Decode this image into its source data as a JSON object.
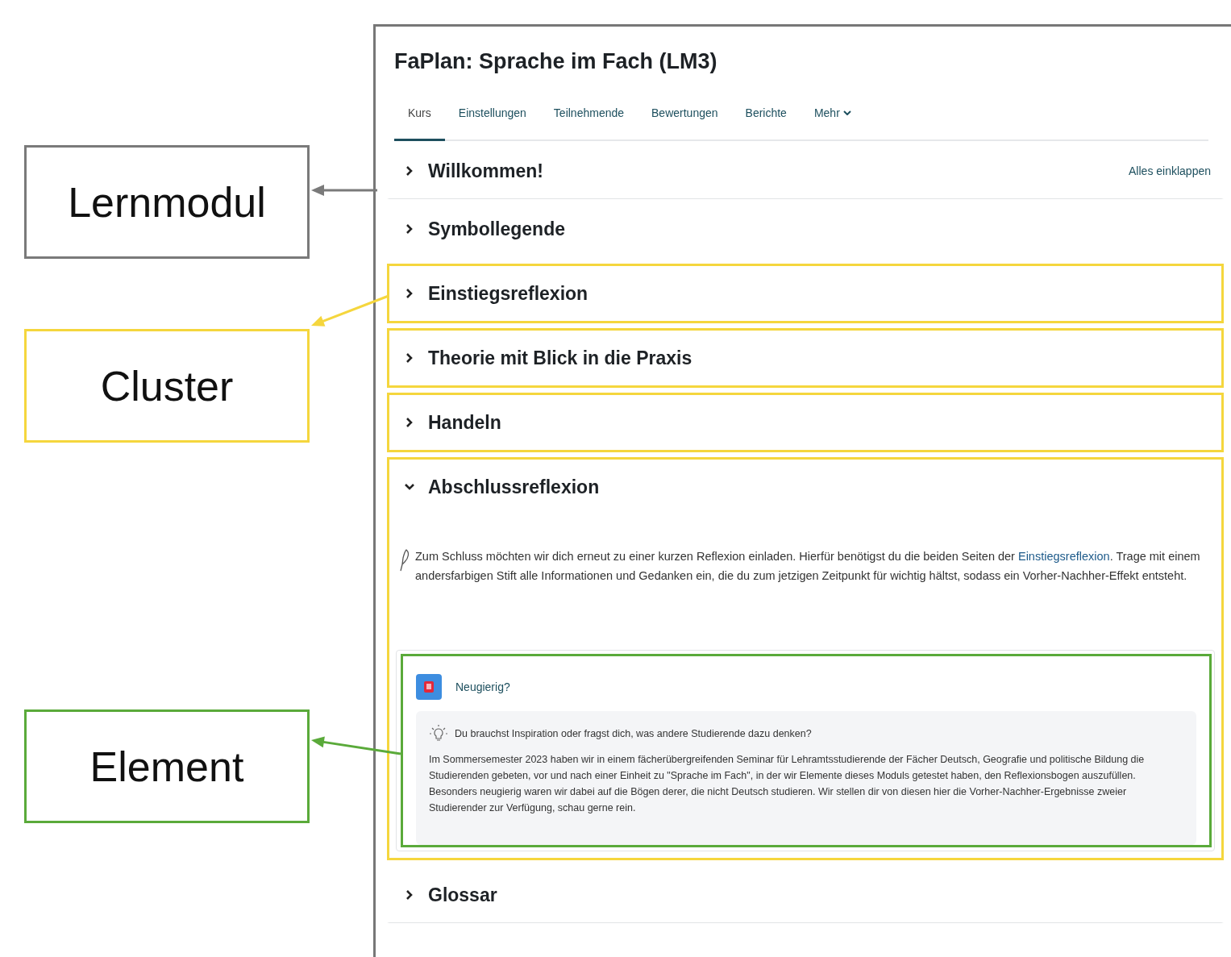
{
  "annotations": [
    {
      "label": "Lernmodul",
      "color": "#7a7a7a"
    },
    {
      "label": "Cluster",
      "color": "#f5d63d"
    },
    {
      "label": "Element",
      "color": "#5aaa3a"
    }
  ],
  "course": {
    "title": "FaPlan: Sprache im Fach (LM3)",
    "tabs": [
      {
        "label": "Kurs",
        "selected": true,
        "dropdown": false
      },
      {
        "label": "Einstellungen",
        "selected": false,
        "dropdown": false
      },
      {
        "label": "Teilnehmende",
        "selected": false,
        "dropdown": false
      },
      {
        "label": "Bewertungen",
        "selected": false,
        "dropdown": false
      },
      {
        "label": "Berichte",
        "selected": false,
        "dropdown": false
      },
      {
        "label": "Mehr",
        "selected": false,
        "dropdown": true
      }
    ],
    "collapse_all": "Alles einklappen",
    "sections": [
      {
        "title": "Willkommen!",
        "expanded": false,
        "outlined": false
      },
      {
        "title": "Symbollegende",
        "expanded": false,
        "outlined": false
      },
      {
        "title": "Einstiegsreflexion",
        "expanded": false,
        "outlined": true
      },
      {
        "title": "Theorie mit Blick in die Praxis",
        "expanded": false,
        "outlined": true
      },
      {
        "title": "Handeln",
        "expanded": false,
        "outlined": true
      },
      {
        "title": "Abschlussreflexion",
        "expanded": true,
        "outlined": true,
        "intro": {
          "before": "Zum Schluss möchten wir dich erneut zu einer kurzen Reflexion einladen. Hierfür benötigst du die beiden Seiten der ",
          "link": "Einstiegsreflexion",
          "after": ". Trage mit einem andersfarbigen Stift alle Informationen und Gedanken ein, die du zum jetzigen Zeitpunkt für wichtig hältst, sodass ein Vorher-Nachher-Effekt entsteht."
        },
        "activity": {
          "title": "Neugierig?",
          "outlined": true,
          "hint": "Du brauchst Inspiration oder fragst dich, was andere Studierende dazu denken?",
          "text": "Im Sommersemester 2023 haben wir in einem fächerübergreifenden Seminar für Lehramtsstudierende der Fächer Deutsch, Geografie und politische Bildung die Studierenden gebeten, vor und nach einer Einheit zu \"Sprache im Fach\", in der wir Elemente dieses Moduls getestet haben, den Reflexionsbogen auszufüllen. Besonders neugierig waren wir dabei auf die Bögen derer, die nicht Deutsch studieren. Wir stellen dir von diesen hier die Vorher-Nachher-Ergebnisse zweier Studierender zur Verfügung, schau gerne rein."
        }
      },
      {
        "title": "Glossar",
        "expanded": false,
        "outlined": false
      }
    ]
  }
}
